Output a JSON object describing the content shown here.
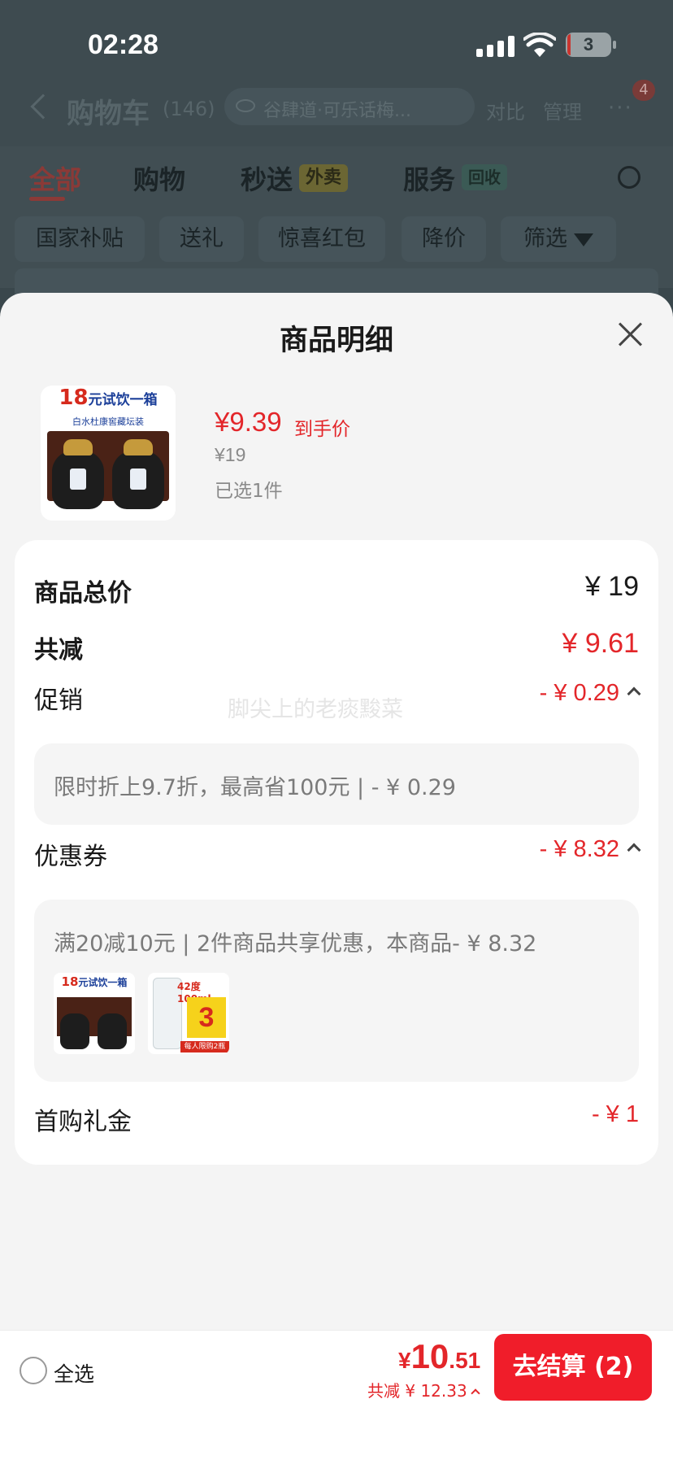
{
  "status_bar": {
    "time": "02:28",
    "battery": "3"
  },
  "cart_header": {
    "title": "购物车",
    "count": "(146)",
    "search_text": "谷肆道·可乐话梅...",
    "compare": "对比",
    "manage": "管理",
    "more": "···",
    "badge": "4"
  },
  "tabs": [
    {
      "label": "全部"
    },
    {
      "label": "购物"
    },
    {
      "label": "秒送"
    },
    {
      "label": "服务"
    }
  ],
  "tab_tags": {
    "miaosong": "外卖",
    "service": "回收"
  },
  "filters": [
    "国家补贴",
    "送礼",
    "惊喜红包",
    "降价",
    "筛选"
  ],
  "sheet": {
    "title": "商品明细",
    "product": {
      "thumb_num": "18",
      "thumb_text": "元试饮一箱",
      "thumb_sub": "白水杜康窖藏坛装",
      "price": "¥9.39",
      "price_tag": "到手价",
      "original_price": "¥19",
      "selected": "已选1件"
    },
    "watermark": "脚尖上的老痰黢菜",
    "rows": {
      "total_label": "商品总价",
      "total_value": "¥ 19",
      "reduce_label": "共减",
      "reduce_value": "¥ 9.61",
      "promo_label": "促销",
      "promo_value": "- ¥ 0.29",
      "promo_detail": "限时折上9.7折，最高省100元 | - ¥ 0.29",
      "coupon_label": "优惠券",
      "coupon_value": "- ¥ 8.32",
      "coupon_detail": "满20减10元 | 2件商品共享优惠，本商品- ¥ 8.32",
      "gift_label": "首购礼金",
      "gift_value": "- ¥ 1"
    },
    "coupon_items": {
      "item1_num": "18",
      "item1_text": "元试饮一箱",
      "item2_spec": "42度100ml",
      "item2_price": "3",
      "item2_limit": "每人限购2瓶"
    }
  },
  "checkout": {
    "select_all": "全选",
    "total_currency": "¥",
    "total_int": "10",
    "total_dec": ".51",
    "saved": "共减 ¥ 12.33",
    "button": "去结算 (2)"
  },
  "colors": {
    "accent_red": "#e3262a",
    "button_red": "#f01d2a"
  }
}
